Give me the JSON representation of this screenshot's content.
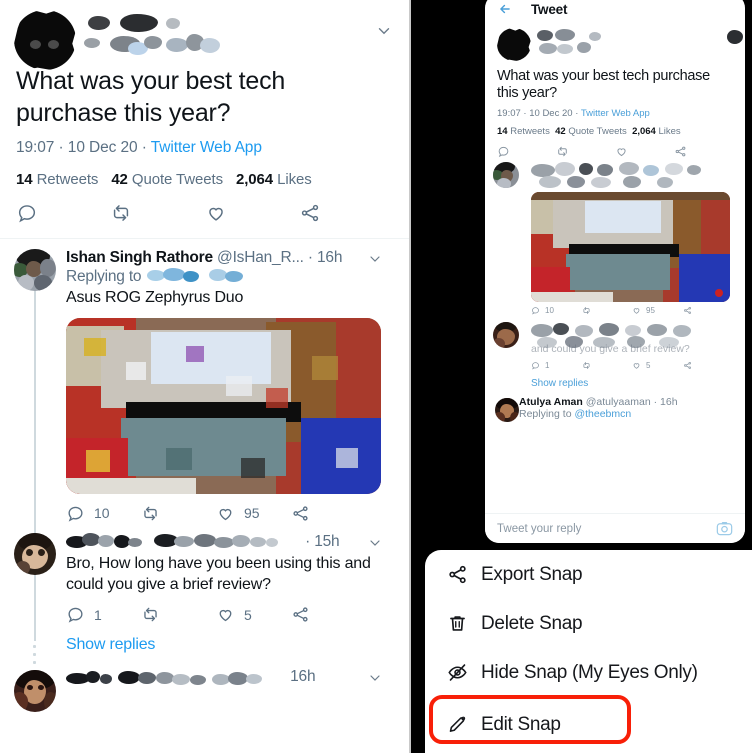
{
  "left_panel": {
    "main_tweet": {
      "author_redacted": true,
      "text": "What was your best tech purchase this year?",
      "time": "19:07",
      "date": "10 Dec 20",
      "source": "Twitter Web App",
      "separator": "·",
      "stats": {
        "retweets_count": "14",
        "retweets_label": "Retweets",
        "quotes_count": "42",
        "quotes_label": "Quote Tweets",
        "likes_count": "2,064",
        "likes_label": "Likes"
      },
      "actions": [
        "reply-icon",
        "retweet-icon",
        "like-icon",
        "share-icon"
      ],
      "caret": "chevron-down-icon"
    },
    "replies": [
      {
        "name": "Ishan Singh Rathore",
        "handle": "@IsHan_R...",
        "time": "16h",
        "replying_to": "Replying to",
        "replying_to_redacted": true,
        "text": "Asus ROG Zephyrus Duo",
        "has_image": true,
        "reply_count": "10",
        "retweet_count": "",
        "like_count": "95",
        "caret": "chevron-down-icon"
      },
      {
        "name_redacted": true,
        "time": "15h",
        "text": "Bro, How long have you been using this and could you give a brief review?",
        "has_image": false,
        "reply_count": "1",
        "retweet_count": "",
        "like_count": "5",
        "show_replies": "Show replies",
        "caret": "chevron-down-icon"
      },
      {
        "name_redacted": true,
        "time": "16h",
        "caret": "chevron-down-icon"
      }
    ]
  },
  "right_panel": {
    "phone_preview": {
      "back": "back-arrow-icon",
      "title": "Tweet",
      "author_redacted": true,
      "text": "What was your best tech purchase this year?",
      "time": "19:07",
      "date": "10 Dec 20",
      "source": "Twitter Web App",
      "separator": "·",
      "stats": {
        "retweets_count": "14",
        "retweets_label": "Retweets",
        "quotes_count": "42",
        "quotes_label": "Quote Tweets",
        "likes_count": "2,064",
        "likes_label": "Likes"
      },
      "reply_one": {
        "reply_count": "10",
        "like_count": "95"
      },
      "reply_two": {
        "text": "and could you give a brief review?",
        "reply_count": "1",
        "like_count": "5",
        "show_replies": "Show replies"
      },
      "reply_three": {
        "name": "Atulya Aman",
        "handle": "@atulyaaman",
        "time": "16h",
        "replying_to_prefix": "Replying to",
        "replying_to_handle": "@theebmcn"
      },
      "composer_placeholder": "Tweet your reply",
      "composer_icon": "camera-icon"
    },
    "context_menu": {
      "items": [
        {
          "label": "Export Snap",
          "icon": "share-icon",
          "highlighted": false
        },
        {
          "label": "Delete Snap",
          "icon": "trash-icon",
          "highlighted": false
        },
        {
          "label": "Hide Snap (My Eyes Only)",
          "icon": "eye-slash-icon",
          "highlighted": false
        },
        {
          "label": "Edit Snap",
          "icon": "pencil-icon",
          "highlighted": true
        }
      ],
      "highlight_color": "#f81f08"
    }
  },
  "colors": {
    "link_blue": "#1d9bf0",
    "text_primary": "#0f1419",
    "text_secondary": "#5b7083",
    "highlight_red": "#f81f08",
    "background_black": "#000000",
    "panel_white": "#ffffff"
  }
}
